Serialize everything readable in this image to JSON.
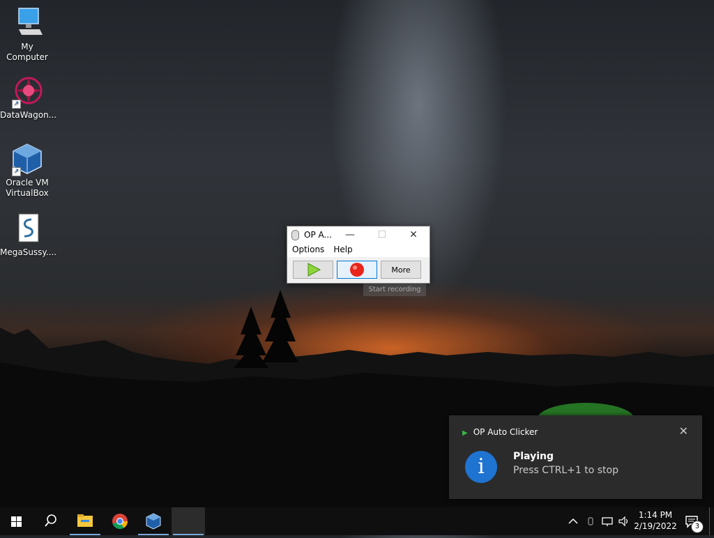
{
  "desktop": {
    "icons": [
      {
        "label": "My Computer",
        "icon": "monitor-icon"
      },
      {
        "label": "DataWagon...",
        "icon": "datawagon-icon"
      },
      {
        "label": "Oracle VM VirtualBox",
        "icon": "virtualbox-icon"
      },
      {
        "label": "MegaSussy....",
        "icon": "script-file-icon"
      }
    ]
  },
  "window": {
    "title": "OP A...",
    "menu": [
      "Options",
      "Help"
    ],
    "buttons": {
      "play": "play-icon",
      "record": "record-icon",
      "more": "More"
    },
    "tooltip": "Start recording"
  },
  "toast": {
    "app_name": "OP Auto Clicker",
    "heading": "Playing",
    "body": "Press CTRL+1 to stop",
    "icon": "info-icon",
    "accent": "#1f73d1"
  },
  "taskbar": {
    "apps": [
      "windows-start-icon",
      "search-icon",
      "file-explorer-icon",
      "chrome-icon",
      "virtualbox-icon",
      "op-auto-clicker-task"
    ],
    "tray": {
      "time": "1:14 PM",
      "date": "2/19/2022",
      "notifications_count": "3"
    }
  }
}
